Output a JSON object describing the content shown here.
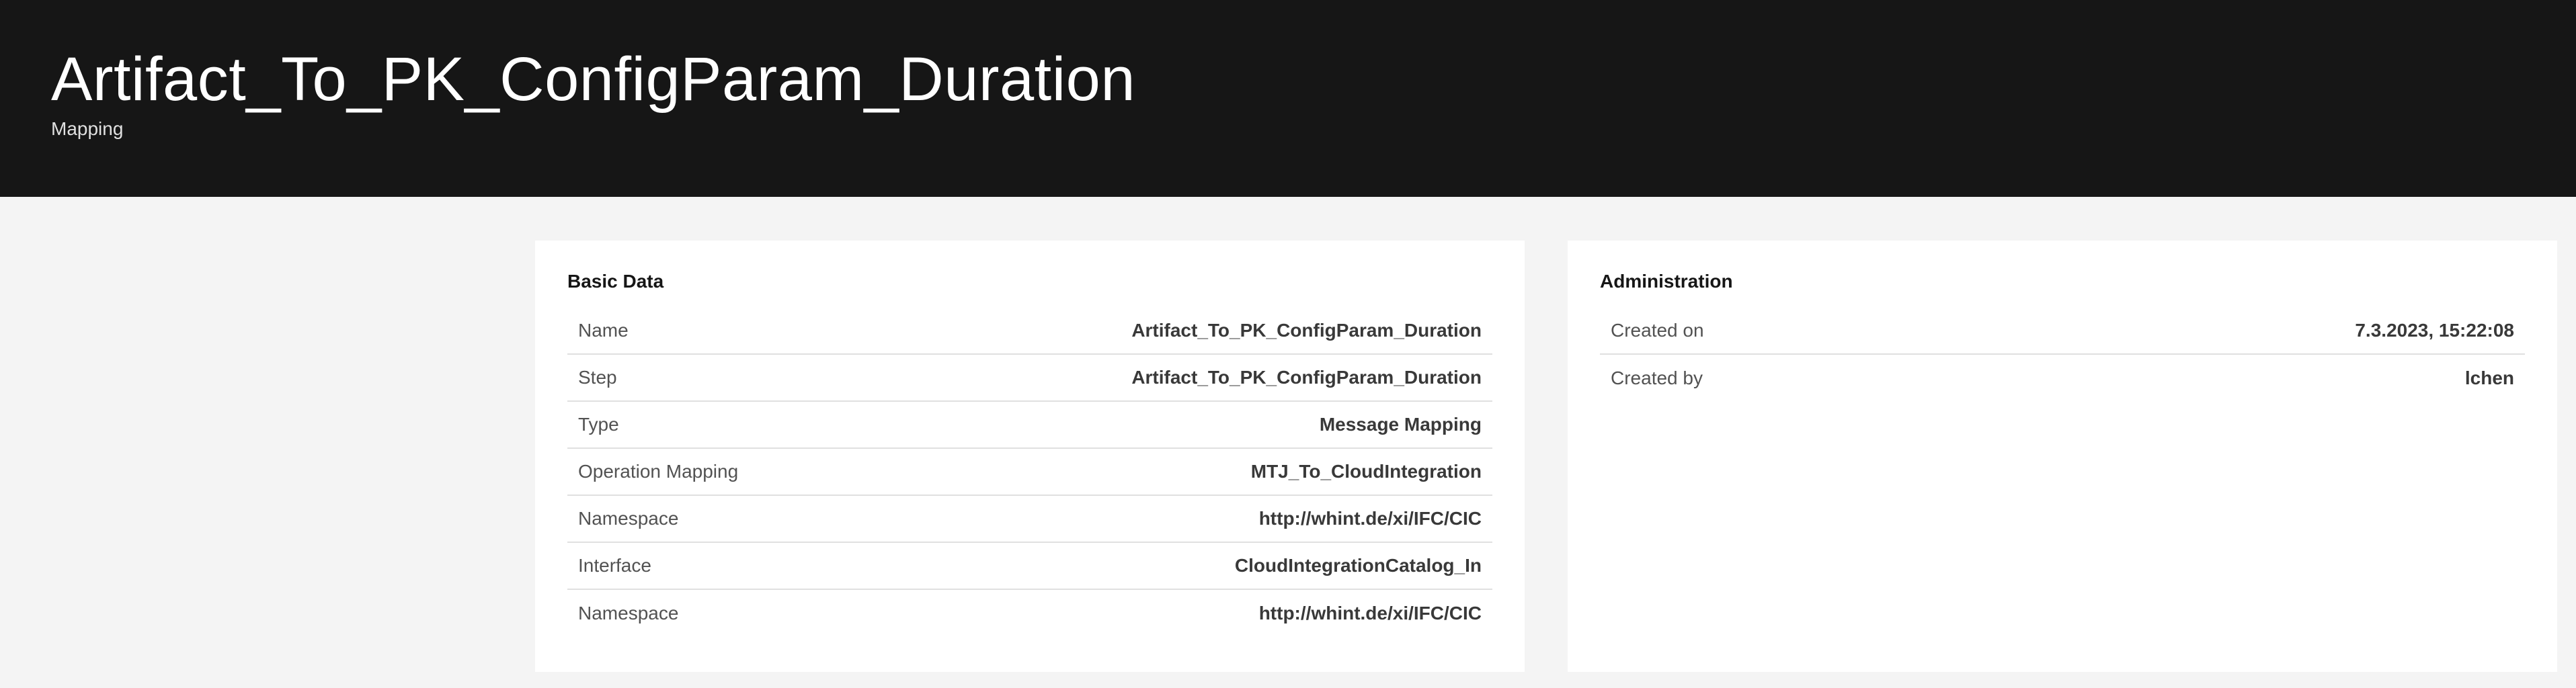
{
  "header": {
    "title": "Artifact_To_PK_ConfigParam_Duration",
    "subtitle": "Mapping"
  },
  "basic_data": {
    "title": "Basic Data",
    "rows": [
      {
        "label": "Name",
        "value": "Artifact_To_PK_ConfigParam_Duration"
      },
      {
        "label": "Step",
        "value": "Artifact_To_PK_ConfigParam_Duration"
      },
      {
        "label": "Type",
        "value": "Message Mapping"
      },
      {
        "label": "Operation Mapping",
        "value": "MTJ_To_CloudIntegration"
      },
      {
        "label": "Namespace",
        "value": "http://whint.de/xi/IFC/CIC"
      },
      {
        "label": "Interface",
        "value": "CloudIntegrationCatalog_In"
      },
      {
        "label": "Namespace",
        "value": "http://whint.de/xi/IFC/CIC"
      }
    ]
  },
  "administration": {
    "title": "Administration",
    "rows": [
      {
        "label": "Created on",
        "value": "7.3.2023, 15:22:08"
      },
      {
        "label": "Created by",
        "value": "lchen"
      }
    ]
  },
  "colors": {
    "header_bg": "#161616",
    "page_bg": "#f4f4f4",
    "tile_bg": "#ffffff",
    "divider": "#e0e0e0"
  }
}
